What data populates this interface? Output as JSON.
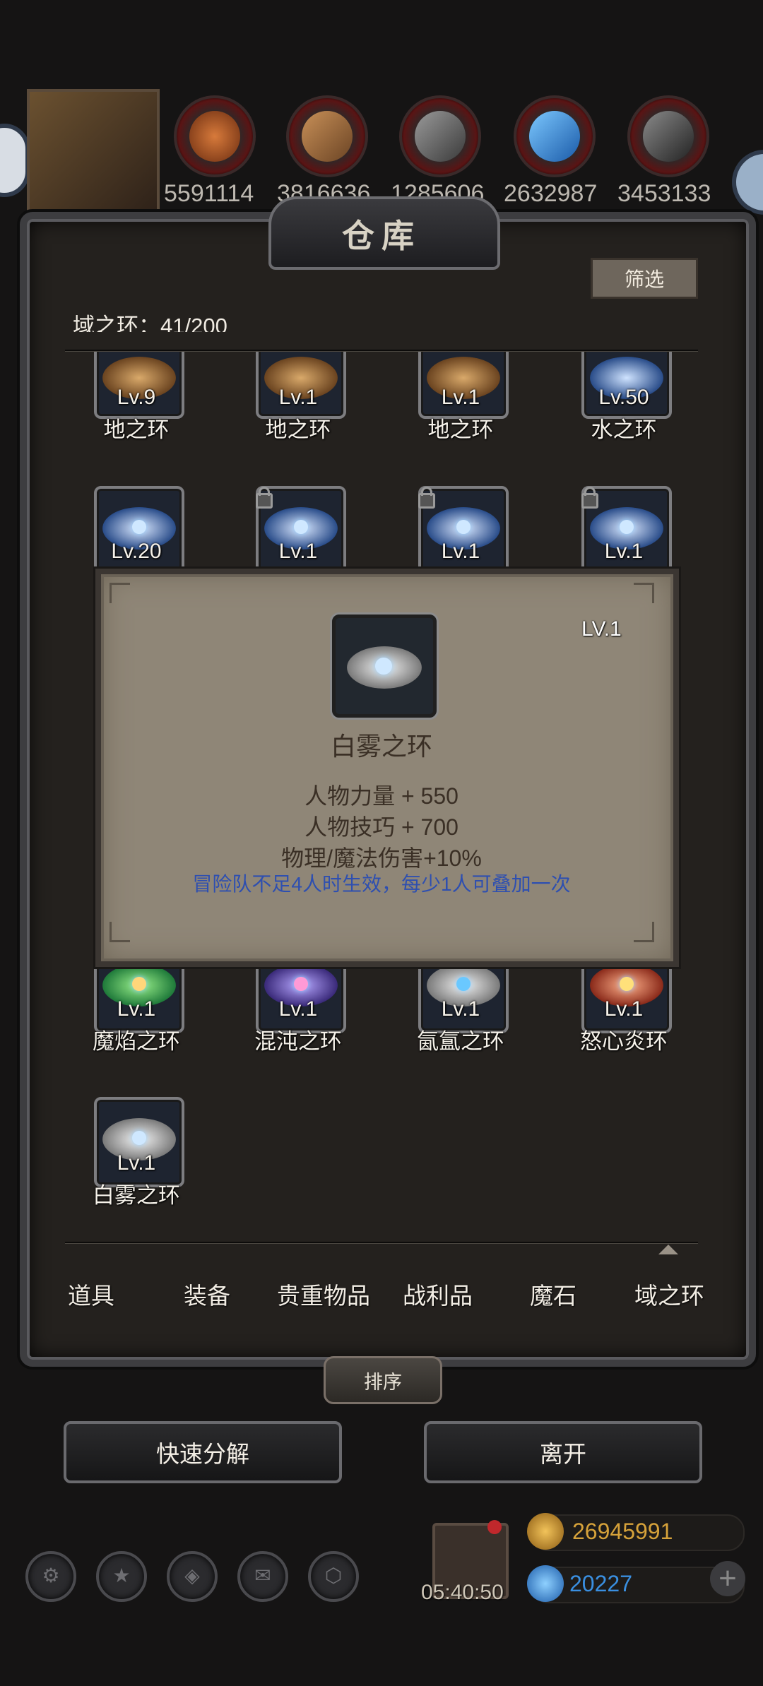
{
  "top_resources": [
    {
      "icon": "ore-red-icon",
      "value": "5591114"
    },
    {
      "icon": "wood-plank-icon",
      "value": "3816636"
    },
    {
      "icon": "iron-ingot-icon",
      "value": "1285606"
    },
    {
      "icon": "blue-crystal-icon",
      "value": "2632987"
    },
    {
      "icon": "dark-stone-icon",
      "value": "3453133"
    }
  ],
  "panel": {
    "title": "仓库",
    "filter_label": "筛选",
    "capacity": "域之环：41/200"
  },
  "items": [
    {
      "level": "Lv.9",
      "name": "地之环",
      "theme": "earth"
    },
    {
      "level": "Lv.1",
      "name": "地之环",
      "theme": "earth"
    },
    {
      "level": "Lv.1",
      "name": "地之环",
      "theme": "earth"
    },
    {
      "level": "Lv.50",
      "name": "水之环",
      "theme": "water"
    },
    {
      "level": "Lv.20",
      "name": "",
      "theme": "water",
      "locked": false
    },
    {
      "level": "Lv.1",
      "name": "",
      "theme": "water",
      "locked": true
    },
    {
      "level": "Lv.1",
      "name": "",
      "theme": "water",
      "locked": true
    },
    {
      "level": "Lv.1",
      "name": "",
      "theme": "water",
      "locked": true
    },
    {
      "level": "Lv.1",
      "name": "魔焰之环",
      "theme": "green"
    },
    {
      "level": "Lv.1",
      "name": "混沌之环",
      "theme": "purple"
    },
    {
      "level": "Lv.1",
      "name": "氤氲之环",
      "theme": "mist"
    },
    {
      "level": "Lv.1",
      "name": "怒心炎环",
      "theme": "fire"
    },
    {
      "level": "Lv.1",
      "name": "白雾之环",
      "theme": "mist"
    }
  ],
  "tabs": [
    "道具",
    "装备",
    "贵重物品",
    "战利品",
    "魔石",
    "域之环"
  ],
  "sort_label": "排序",
  "actions": {
    "decompose": "快速分解",
    "leave": "离开"
  },
  "bottom": {
    "timer": "05:40:50",
    "gold": "26945991",
    "gems": "20227"
  },
  "popup": {
    "level": "LV.1",
    "name": "白雾之环",
    "stats": [
      "人物力量 + 550",
      "人物技巧 + 700",
      "物理/魔法伤害+10%"
    ],
    "note": "冒险队不足4人时生效，每少1人可叠加一次"
  },
  "colors": {
    "panel_bg": "#24211e",
    "popup_bg": "#8f8677",
    "note_blue": "#2e4fb0",
    "gold": "#d6a23a",
    "gem": "#3a8fe0"
  }
}
